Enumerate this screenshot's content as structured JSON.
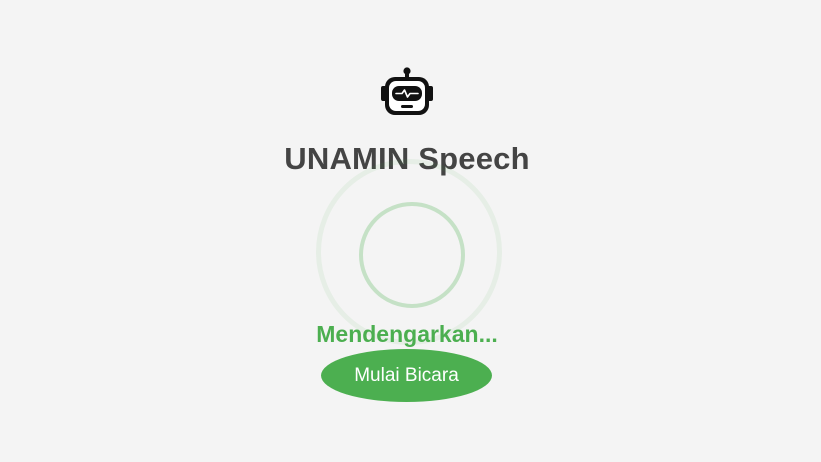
{
  "app": {
    "logo_icon": "robot-icon",
    "title": "UNAMIN Speech",
    "status": "Mendengarkan...",
    "listening_indicator_icon": "listening-pulse-icon",
    "start_button_label": "Mulai Bicara"
  },
  "colors": {
    "background": "#f4f4f4",
    "accent": "#4caf50",
    "title_text": "#444444",
    "button_text": "#ffffff"
  }
}
